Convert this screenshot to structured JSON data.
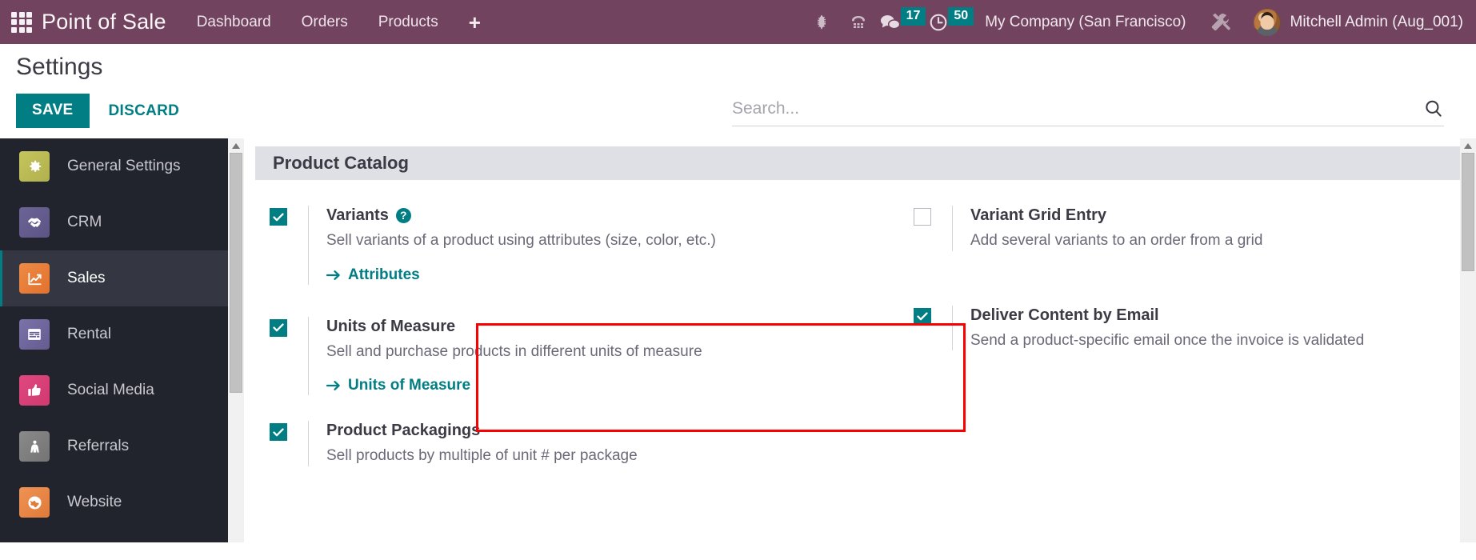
{
  "navbar": {
    "apps_icon": "apps-grid-icon",
    "brand": "Point of Sale",
    "menu": [
      {
        "label": "Dashboard"
      },
      {
        "label": "Orders"
      },
      {
        "label": "Products"
      }
    ],
    "plus_label": "+",
    "icons": [
      {
        "name": "bug-icon"
      },
      {
        "name": "dialpad-icon"
      }
    ],
    "messages": {
      "icon": "chat-bubble-icon",
      "count": "17"
    },
    "activities": {
      "icon": "clock-icon",
      "count": "50"
    },
    "company": "My Company (San Francisco)",
    "tools_icon": "tools-icon",
    "user": "Mitchell Admin (Aug_001)"
  },
  "control_panel": {
    "title": "Settings",
    "save_label": "SAVE",
    "discard_label": "DISCARD"
  },
  "search": {
    "placeholder": "Search...",
    "value": "",
    "icon": "search-icon"
  },
  "sidebar": {
    "items": [
      {
        "label": "General Settings",
        "icon": "gear-icon",
        "active": false
      },
      {
        "label": "CRM",
        "icon": "handshake-icon",
        "active": false
      },
      {
        "label": "Sales",
        "icon": "chart-line-icon",
        "active": true
      },
      {
        "label": "Rental",
        "icon": "calendar-icon",
        "active": false
      },
      {
        "label": "Social Media",
        "icon": "thumbs-up-icon",
        "active": false
      },
      {
        "label": "Referrals",
        "icon": "person-icon",
        "active": false
      },
      {
        "label": "Website",
        "icon": "globe-icon",
        "active": false
      }
    ]
  },
  "main": {
    "section_title": "Product Catalog",
    "settings_left": [
      {
        "title": "Variants",
        "help": "?",
        "desc": "Sell variants of a product using attributes (size, color, etc.)",
        "checked": true,
        "link": "Attributes",
        "highlighted": true
      },
      {
        "title": "Units of Measure",
        "desc": "Sell and purchase products in different units of measure",
        "checked": true,
        "link": "Units of Measure"
      },
      {
        "title": "Product Packagings",
        "desc": "Sell products by multiple of unit # per package",
        "checked": true,
        "link": ""
      }
    ],
    "settings_right": [
      {
        "title": "Variant Grid Entry",
        "desc": "Add several variants to an order from a grid",
        "checked": false,
        "link": ""
      },
      {
        "title": "Deliver Content by Email",
        "desc": "Send a product-specific email once the invoice is validated",
        "checked": true,
        "link": ""
      }
    ]
  },
  "colors": {
    "navbar": "#71435f",
    "accent_teal": "#017e84",
    "sidebar_bg": "#21242c",
    "sidebar_active": "#343741",
    "highlight_red": "#fa0000",
    "section_header": "#dfe0e6"
  }
}
